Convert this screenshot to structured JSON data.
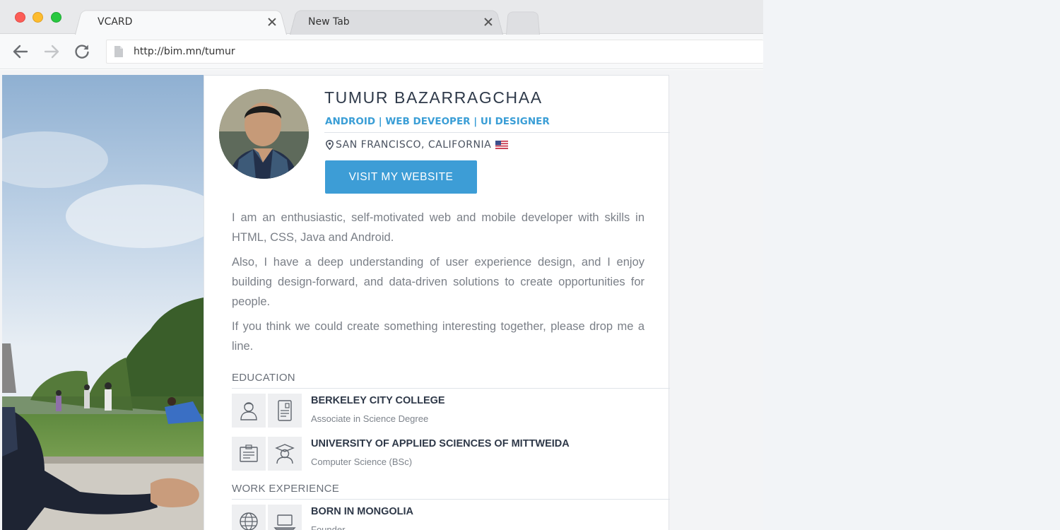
{
  "browser": {
    "tabs": [
      {
        "label": "VCARD",
        "active": true
      },
      {
        "label": "New Tab",
        "active": false
      }
    ],
    "url": "http://bim.mn/tumur"
  },
  "profile": {
    "name": "TUMUR BAZARRAGCHAA",
    "roles": "ANDROID | WEB DEVEOPER | UI DESIGNER",
    "location": "SAN FRANCISCO, CALIFORNIA",
    "cta_label": "VISIT MY WEBSITE",
    "bio": [
      "I am an enthusiastic, self-motivated web and mobile developer with skills in HTML, CSS, Java and Android.",
      "Also, I have a deep understanding of user experience design, and I enjoy building design-forward, and data-driven solutions to create opportunities for people.",
      "If you think we could create something interesting together, please drop me a line."
    ]
  },
  "education": {
    "title": "EDUCATION",
    "items": [
      {
        "title": "BERKELEY CITY COLLEGE",
        "subtitle": "Associate in Science Degree",
        "icons": [
          "person-icon",
          "id-card-icon"
        ]
      },
      {
        "title": "UNIVERSITY OF APPLIED SCIENCES OF MITTWEIDA",
        "subtitle": "Computer Science (BSc)",
        "icons": [
          "certificate-icon",
          "graduate-icon"
        ]
      }
    ]
  },
  "work": {
    "title": "WORK EXPERIENCE",
    "items": [
      {
        "title": "BORN IN MONGOLIA",
        "subtitle": "Founder",
        "icons": [
          "globe-icon",
          "laptop-icon"
        ]
      }
    ]
  },
  "colors": {
    "accent": "#3d9dd6",
    "name": "#2f3a4a",
    "body_text": "#7a7f87"
  }
}
